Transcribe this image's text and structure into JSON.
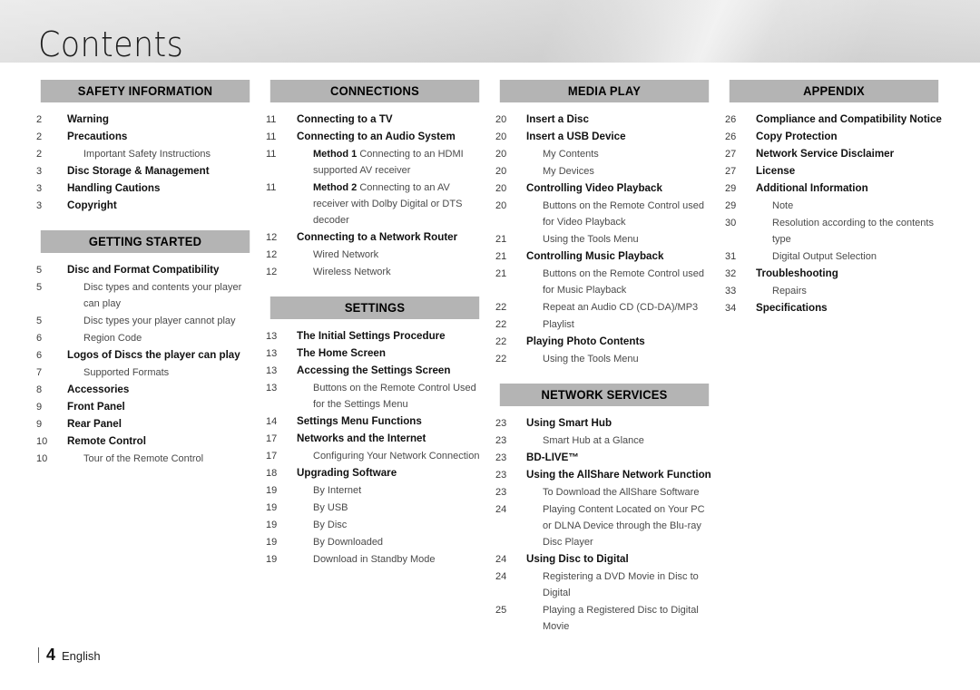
{
  "page_title": "Contents",
  "footer": {
    "page_number": "4",
    "language": "English"
  },
  "colors": {
    "section_header_bg": "#b4b4b4",
    "banner_top": "#e2e2e2",
    "banner_bottom": "#d2d2d2",
    "text_primary": "#111111",
    "text_secondary": "#4a4a4a"
  },
  "columns": [
    {
      "id": "column-1",
      "blocks": [
        {
          "header": "SAFETY INFORMATION",
          "entries": [
            {
              "page": "2",
              "level": 1,
              "text": "Warning"
            },
            {
              "page": "2",
              "level": 1,
              "text": "Precautions"
            },
            {
              "page": "2",
              "level": 2,
              "text": "Important Safety Instructions"
            },
            {
              "page": "3",
              "level": 1,
              "text": "Disc Storage & Management"
            },
            {
              "page": "3",
              "level": 1,
              "text": "Handling Cautions"
            },
            {
              "page": "3",
              "level": 1,
              "text": "Copyright"
            }
          ]
        },
        {
          "header": "GETTING STARTED",
          "entries": [
            {
              "page": "5",
              "level": 1,
              "text": "Disc and Format Compatibility"
            },
            {
              "page": "5",
              "level": 2,
              "text": "Disc types and contents your player can play"
            },
            {
              "page": "5",
              "level": 2,
              "text": "Disc types your player cannot play"
            },
            {
              "page": "6",
              "level": 2,
              "text": "Region Code"
            },
            {
              "page": "6",
              "level": 1,
              "text": "Logos of Discs the player can play"
            },
            {
              "page": "7",
              "level": 2,
              "text": "Supported Formats"
            },
            {
              "page": "8",
              "level": 1,
              "text": "Accessories"
            },
            {
              "page": "9",
              "level": 1,
              "text": "Front Panel"
            },
            {
              "page": "9",
              "level": 1,
              "text": "Rear Panel"
            },
            {
              "page": "10",
              "level": 1,
              "text": "Remote Control"
            },
            {
              "page": "10",
              "level": 2,
              "text": "Tour of the Remote Control"
            }
          ]
        }
      ]
    },
    {
      "id": "column-2",
      "blocks": [
        {
          "header": "CONNECTIONS",
          "entries": [
            {
              "page": "11",
              "level": 1,
              "text": "Connecting to a TV"
            },
            {
              "page": "11",
              "level": 1,
              "text": "Connecting to an Audio System"
            },
            {
              "page": "11",
              "level": 2,
              "bold_prefix": "Method 1",
              "text": "Connecting to an HDMI supported AV receiver"
            },
            {
              "page": "11",
              "level": 2,
              "bold_prefix": "Method 2",
              "text": "Connecting to an AV receiver with Dolby Digital or DTS decoder"
            },
            {
              "page": "12",
              "level": 1,
              "text": "Connecting to a Network Router"
            },
            {
              "page": "12",
              "level": 2,
              "text": "Wired Network"
            },
            {
              "page": "12",
              "level": 2,
              "text": "Wireless Network"
            }
          ]
        },
        {
          "header": "SETTINGS",
          "entries": [
            {
              "page": "13",
              "level": 1,
              "text": "The Initial Settings Procedure"
            },
            {
              "page": "13",
              "level": 1,
              "text": "The Home Screen"
            },
            {
              "page": "13",
              "level": 1,
              "text": "Accessing the Settings Screen"
            },
            {
              "page": "13",
              "level": 2,
              "text": "Buttons on the Remote Control Used for the Settings Menu"
            },
            {
              "page": "14",
              "level": 1,
              "text": "Settings Menu Functions"
            },
            {
              "page": "17",
              "level": 1,
              "text": "Networks and the Internet"
            },
            {
              "page": "17",
              "level": 2,
              "text": "Configuring Your Network Connection"
            },
            {
              "page": "18",
              "level": 1,
              "text": "Upgrading Software"
            },
            {
              "page": "19",
              "level": 2,
              "text": "By Internet"
            },
            {
              "page": "19",
              "level": 2,
              "text": "By USB"
            },
            {
              "page": "19",
              "level": 2,
              "text": "By Disc"
            },
            {
              "page": "19",
              "level": 2,
              "text": "By Downloaded"
            },
            {
              "page": "19",
              "level": 2,
              "text": "Download in Standby Mode"
            }
          ]
        }
      ]
    },
    {
      "id": "column-3",
      "blocks": [
        {
          "header": "MEDIA PLAY",
          "entries": [
            {
              "page": "20",
              "level": 1,
              "text": "Insert a Disc"
            },
            {
              "page": "20",
              "level": 1,
              "text": "Insert a USB Device"
            },
            {
              "page": "20",
              "level": 2,
              "text": "My Contents"
            },
            {
              "page": "20",
              "level": 2,
              "text": "My Devices"
            },
            {
              "page": "20",
              "level": 1,
              "text": "Controlling Video Playback"
            },
            {
              "page": "20",
              "level": 2,
              "text": "Buttons on the Remote Control used for Video Playback"
            },
            {
              "page": "21",
              "level": 2,
              "text": "Using the Tools Menu"
            },
            {
              "page": "21",
              "level": 1,
              "text": "Controlling Music Playback"
            },
            {
              "page": "21",
              "level": 2,
              "text": "Buttons on the Remote Control used for Music Playback"
            },
            {
              "page": "22",
              "level": 2,
              "text": "Repeat an Audio CD (CD-DA)/MP3"
            },
            {
              "page": "22",
              "level": 2,
              "text": "Playlist"
            },
            {
              "page": "22",
              "level": 1,
              "text": "Playing Photo Contents"
            },
            {
              "page": "22",
              "level": 2,
              "text": "Using the Tools Menu"
            }
          ]
        },
        {
          "header": "NETWORK SERVICES",
          "entries": [
            {
              "page": "23",
              "level": 1,
              "text": "Using Smart Hub"
            },
            {
              "page": "23",
              "level": 2,
              "text": "Smart Hub at a Glance"
            },
            {
              "page": "23",
              "level": 1,
              "text": "BD-LIVE™"
            },
            {
              "page": "23",
              "level": 1,
              "text": "Using the AllShare Network Function"
            },
            {
              "page": "23",
              "level": 2,
              "text": "To Download the AllShare Software"
            },
            {
              "page": "24",
              "level": 2,
              "text": "Playing Content Located on Your PC or DLNA Device through the Blu-ray Disc Player"
            },
            {
              "page": "24",
              "level": 1,
              "text": "Using Disc to Digital"
            },
            {
              "page": "24",
              "level": 2,
              "text": "Registering a DVD Movie in Disc to Digital"
            },
            {
              "page": "25",
              "level": 2,
              "text": "Playing a Registered Disc to Digital Movie"
            }
          ]
        }
      ]
    },
    {
      "id": "column-4",
      "blocks": [
        {
          "header": "APPENDIX",
          "entries": [
            {
              "page": "26",
              "level": 1,
              "text": "Compliance and Compatibility Notice"
            },
            {
              "page": "26",
              "level": 1,
              "text": "Copy Protection"
            },
            {
              "page": "27",
              "level": 1,
              "text": "Network Service Disclaimer"
            },
            {
              "page": "27",
              "level": 1,
              "text": "License"
            },
            {
              "page": "29",
              "level": 1,
              "text": "Additional Information"
            },
            {
              "page": "29",
              "level": 2,
              "text": "Note"
            },
            {
              "page": "30",
              "level": 2,
              "text": "Resolution according to the contents type"
            },
            {
              "page": "31",
              "level": 2,
              "text": "Digital Output Selection"
            },
            {
              "page": "32",
              "level": 1,
              "text": "Troubleshooting"
            },
            {
              "page": "33",
              "level": 2,
              "text": "Repairs"
            },
            {
              "page": "34",
              "level": 1,
              "text": "Specifications"
            }
          ]
        }
      ]
    }
  ]
}
